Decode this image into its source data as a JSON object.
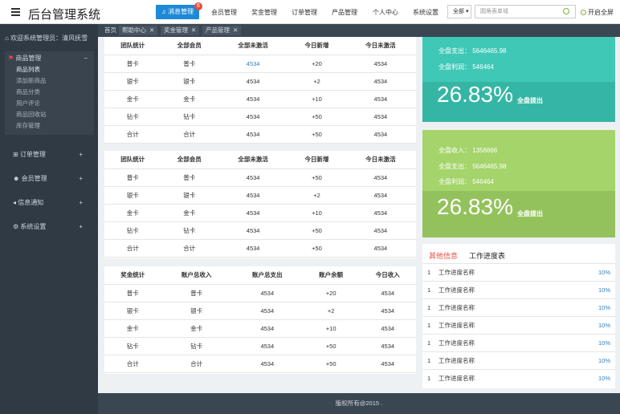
{
  "header": {
    "title": "后台管理系统",
    "message_label": "消息管理",
    "message_count": "6",
    "nav": [
      "会员管理",
      "奖金管理",
      "订单管理",
      "产品管理",
      "个人中心",
      "系统设置"
    ],
    "search_scope": "全部",
    "search_placeholder": "圆角表单域",
    "fullscreen_label": "开启全屏"
  },
  "sidebar": {
    "welcome": "欢迎系统管理员：清风抚雪",
    "product_group": {
      "label": "商品管理",
      "toggle": "−",
      "items": [
        "商品列表",
        "添加新商品",
        "商品分类",
        "用户评论",
        "商品回收站",
        "库存管理"
      ]
    },
    "sections": [
      {
        "label": "订单管理",
        "toggle": "+"
      },
      {
        "label": "会员管理",
        "toggle": "+"
      },
      {
        "label": "信息通知",
        "toggle": "+"
      },
      {
        "label": "系统设置",
        "toggle": "+"
      }
    ]
  },
  "tabs": [
    {
      "label": "首页",
      "closable": false
    },
    {
      "label": "帮助中心",
      "closable": true
    },
    {
      "label": "奖金管理",
      "closable": true
    },
    {
      "label": "产品管理",
      "closable": true
    }
  ],
  "table1": {
    "headers": [
      "团队统计",
      "全部会员",
      "全部未激活",
      "今日新增",
      "今日未激活"
    ],
    "rows": [
      [
        "普卡",
        "普卡",
        "4534",
        "+20",
        "4534"
      ],
      [
        "银卡",
        "银卡",
        "4534",
        "+2",
        "4534"
      ],
      [
        "金卡",
        "金卡",
        "4534",
        "+10",
        "4534"
      ],
      [
        "钻卡",
        "钻卡",
        "4534",
        "+50",
        "4534"
      ],
      [
        "合计",
        "合计",
        "4534",
        "+50",
        "4534"
      ]
    ]
  },
  "table2": {
    "headers": [
      "团队统计",
      "全部会员",
      "全部未激活",
      "今日新增",
      "今日未激活"
    ],
    "rows": [
      [
        "普卡",
        "普卡",
        "4534",
        "+50",
        "4534"
      ],
      [
        "银卡",
        "银卡",
        "4534",
        "+2",
        "4534"
      ],
      [
        "金卡",
        "金卡",
        "4534",
        "+10",
        "4534"
      ],
      [
        "钻卡",
        "钻卡",
        "4534",
        "+50",
        "4534"
      ],
      [
        "合计",
        "合计",
        "4534",
        "+50",
        "4534"
      ]
    ]
  },
  "table3": {
    "headers": [
      "奖金统计",
      "账户总收入",
      "账户总支出",
      "账户余额",
      "今日收入"
    ],
    "rows": [
      [
        "普卡",
        "普卡",
        "4534",
        "+20",
        "4534"
      ],
      [
        "银卡",
        "银卡",
        "4534",
        "+2",
        "4534"
      ],
      [
        "金卡",
        "金卡",
        "4534",
        "+10",
        "4534"
      ],
      [
        "钻卡",
        "钻卡",
        "4534",
        "+50",
        "4534"
      ],
      [
        "合计",
        "合计",
        "4534",
        "+50",
        "4534"
      ]
    ]
  },
  "card1": {
    "expense_line": "全盘支出：  5646465.98",
    "profit_line": "全盘利润：  546464",
    "percent": "26.83%",
    "percent_label": "全盘拨出",
    "color_top": "#3fc8b6",
    "color_bottom": "#35b6a5"
  },
  "card2": {
    "income_line": "全盘收入：  1356666",
    "expense_line": "全盘支出：  5646465.98",
    "profit_line": "全盘利润：  546464",
    "percent": "26.83%",
    "percent_label": "全盘拨出",
    "color_top": "#a4d46a",
    "color_bottom": "#93c25c"
  },
  "info": {
    "tab_other": "其他信息",
    "tab_progress": "工作进度表",
    "rows": [
      {
        "n": "1",
        "name": "工作进度名称",
        "pct": "10%"
      },
      {
        "n": "1",
        "name": "工作进度名称",
        "pct": "10%"
      },
      {
        "n": "1",
        "name": "工作进度名称",
        "pct": "10%"
      },
      {
        "n": "1",
        "name": "工作进度名称",
        "pct": "10%"
      },
      {
        "n": "1",
        "name": "工作进度名称",
        "pct": "10%"
      },
      {
        "n": "1",
        "name": "工作进度名称",
        "pct": "10%"
      },
      {
        "n": "1",
        "name": "工作进度名称",
        "pct": "10%"
      }
    ]
  },
  "footer": "版权所有@2015 ."
}
